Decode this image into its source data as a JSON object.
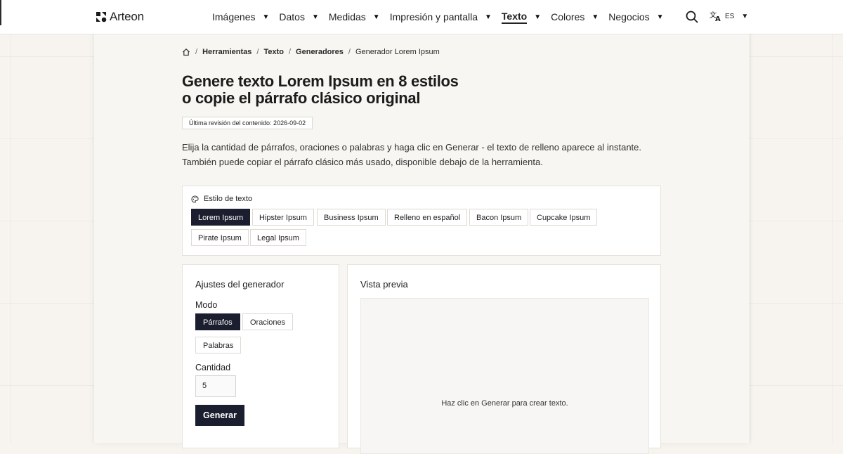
{
  "nav": {
    "brand": "Arteon",
    "menu": [
      {
        "label": "Imágenes",
        "active": false
      },
      {
        "label": "Datos",
        "active": false
      },
      {
        "label": "Medidas",
        "active": false
      },
      {
        "label": "Impresión y pantalla",
        "active": false
      },
      {
        "label": "Texto",
        "active": true
      },
      {
        "label": "Colores",
        "active": false
      },
      {
        "label": "Negocios",
        "active": false
      }
    ],
    "search_icon": "search-icon",
    "lang_icon": "translate-icon",
    "lang": "ES"
  },
  "breadcrumb": [
    "Herramientas",
    "Texto",
    "Generadores",
    "Generador Lorem Ipsum"
  ],
  "page": {
    "title_line1": "Genere texto Lorem Ipsum en 8 estilos",
    "title_line2": "o copie el párrafo clásico original",
    "revision": "Última revisión del contenido: 2026-09-02",
    "lead_line1": "Elija la cantidad de párrafos, oraciones o palabras y haga clic en Generar - el texto de relleno aparece al instante.",
    "lead_line2": "También puede copiar el párrafo clásico más usado, disponible debajo de la herramienta."
  },
  "style": {
    "label": "Estilo de texto",
    "options": [
      "Lorem Ipsum",
      "Hipster Ipsum",
      "Business Ipsum",
      "Relleno en español",
      "Bacon Ipsum",
      "Cupcake Ipsum",
      "Pirate Ipsum",
      "Legal Ipsum"
    ],
    "selected": "Lorem Ipsum"
  },
  "settings": {
    "title": "Ajustes del generador",
    "mode_label": "Modo",
    "modes": [
      "Párrafos",
      "Oraciones",
      "Palabras"
    ],
    "mode_selected": "Párrafos",
    "quantity_label": "Cantidad",
    "quantity": "5",
    "generate": "Generar"
  },
  "preview": {
    "title": "Vista previa",
    "empty_message": "Haz clic en Generar para crear texto."
  },
  "colors": {
    "accent_dark": "#1a1e2e",
    "background": "#f7f4ef"
  }
}
